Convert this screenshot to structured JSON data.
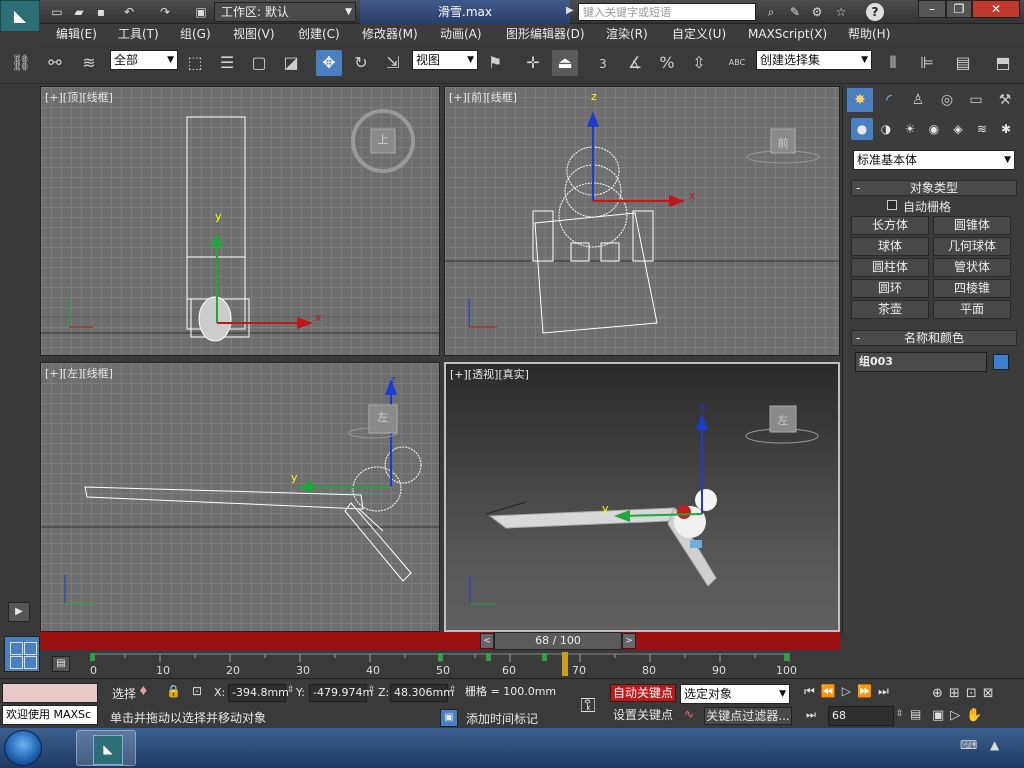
{
  "titlebar": {
    "workspace_label": "工作区: 默认",
    "filename": "滑雪.max",
    "search_placeholder": "键入关键字或短语"
  },
  "menu": [
    "编辑(E)",
    "工具(T)",
    "组(G)",
    "视图(V)",
    "创建(C)",
    "修改器(M)",
    "动画(A)",
    "图形编辑器(D)",
    "渲染(R)",
    "自定义(U)",
    "MAXScript(X)",
    "帮助(H)"
  ],
  "toolbar": {
    "selection_filter": "全部",
    "ref_coord": "视图",
    "named_selection": "创建选择集",
    "snap_3": "3",
    "percent_symbol": "%",
    "abc_label": "ABC"
  },
  "viewports": {
    "top_label": "[+][顶][线框]",
    "front_label": "[+][前][线框]",
    "left_label": "[+][左][线框]",
    "persp_label": "[+][透视][真实]",
    "cube_top": "上",
    "cube_front": "前",
    "cube_left": "左",
    "cube_persp": "左",
    "axis_x": "x",
    "axis_y": "y",
    "axis_z": "z"
  },
  "timeline": {
    "slider_text": "68 / 100",
    "ticks": [
      "0",
      "10",
      "20",
      "30",
      "40",
      "50",
      "60",
      "70",
      "80",
      "90",
      "100"
    ]
  },
  "cmdpanel": {
    "dropdown": "标准基本体",
    "object_type_header": "对象类型",
    "auto_grid": "自动栅格",
    "buttons": [
      "长方体",
      "圆锥体",
      "球体",
      "几何球体",
      "圆柱体",
      "管状体",
      "圆环",
      "四棱锥",
      "茶壶",
      "平面"
    ],
    "name_color_header": "名称和颜色",
    "object_name": "组003",
    "object_color": "#3a7fd0"
  },
  "status": {
    "maxscript_welcome": "欢迎使用 MAXSc",
    "select_label": "选择",
    "x_label": "X:",
    "x_value": "-394.8mm",
    "y_label": "Y:",
    "y_value": "-479.974m",
    "z_label": "Z:",
    "z_value": "48.306mm",
    "grid_label": "栅格 = 100.0mm",
    "prompt": "单击并拖动以选择并移动对象",
    "add_time_tag": "添加时间标记",
    "auto_key": "自动关键点",
    "set_key": "设置关键点",
    "key_mode": "选定对象",
    "key_filters": "关键点过滤器...",
    "frame_value": "68"
  },
  "colors": {
    "accent": "#4a7fc1",
    "timeline_red": "#9a1010",
    "autokey_red": "#c01818"
  }
}
